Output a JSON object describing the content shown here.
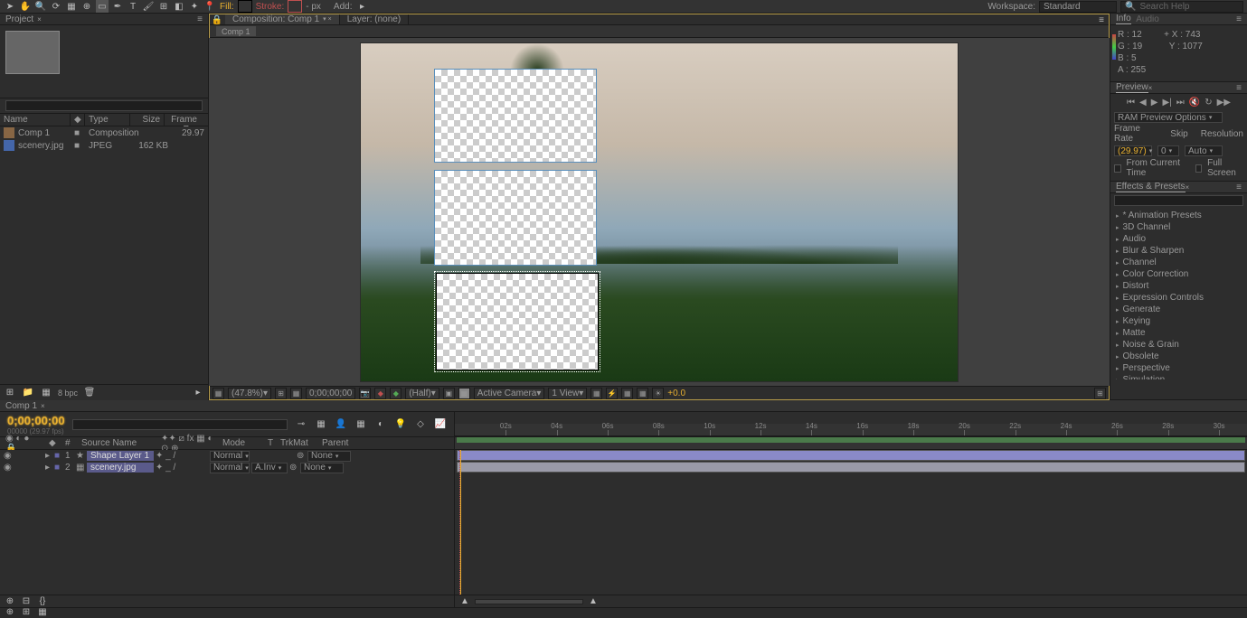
{
  "toolbar": {
    "fill_label": "Fill:",
    "stroke_label": "Stroke:",
    "stroke_px": "px",
    "add_label": "Add:",
    "workspace_label": "Workspace:",
    "workspace_value": "Standard",
    "search_placeholder": "Search Help"
  },
  "project": {
    "tab": "Project",
    "columns": {
      "name": "Name",
      "type": "Type",
      "size": "Size",
      "frame_rate": "Frame R..."
    },
    "items": [
      {
        "name": "Comp 1",
        "type": "Composition",
        "size": "",
        "fr": "29.97"
      },
      {
        "name": "scenery.jpg",
        "type": "JPEG",
        "size": "162 KB",
        "fr": ""
      }
    ],
    "bpc": "8 bpc"
  },
  "composition": {
    "tab_main": "Composition: Comp 1",
    "tab_layer": "Layer: (none)",
    "breadcrumb": "Comp 1",
    "footer": {
      "zoom": "(47.8%)",
      "time": "0;00;00;00",
      "res": "(Half)",
      "camera": "Active Camera",
      "view": "1 View",
      "exp": "+0.0"
    }
  },
  "info": {
    "tab_info": "Info",
    "tab_audio": "Audio",
    "r": "R : 12",
    "g": "G : 19",
    "b": "B : 5",
    "a": "A : 255",
    "x": "X : 743",
    "y": "Y : 1077"
  },
  "preview": {
    "tab": "Preview",
    "options": "RAM Preview Options",
    "frame_rate_label": "Frame Rate",
    "frame_rate": "(29.97)",
    "skip_label": "Skip",
    "skip": "0",
    "res_label": "Resolution",
    "res": "Auto",
    "from_current": "From Current Time",
    "full_screen": "Full Screen"
  },
  "effects": {
    "tab": "Effects & Presets",
    "items": [
      "* Animation Presets",
      "3D Channel",
      "Audio",
      "Blur & Sharpen",
      "Channel",
      "Color Correction",
      "Distort",
      "Expression Controls",
      "Generate",
      "Keying",
      "Matte",
      "Noise & Grain",
      "Obsolete",
      "Perspective",
      "Simulation"
    ]
  },
  "timeline": {
    "tab": "Comp 1",
    "timecode": "0;00;00;00",
    "sub": "00000 (29.97 fps)",
    "col_source": "Source Name",
    "col_mode": "Mode",
    "col_trkmat": "TrkMat",
    "col_parent": "Parent",
    "layers": [
      {
        "num": "1",
        "name": "Shape Layer 1",
        "mode": "Normal",
        "trkmat": "",
        "parent": "None"
      },
      {
        "num": "2",
        "name": "scenery.jpg",
        "mode": "Normal",
        "trkmat": "A.Inv",
        "parent": "None"
      }
    ],
    "ticks": [
      "02s",
      "04s",
      "06s",
      "08s",
      "10s",
      "12s",
      "14s",
      "16s",
      "18s",
      "20s",
      "22s",
      "24s",
      "26s",
      "28s",
      "30s"
    ]
  }
}
